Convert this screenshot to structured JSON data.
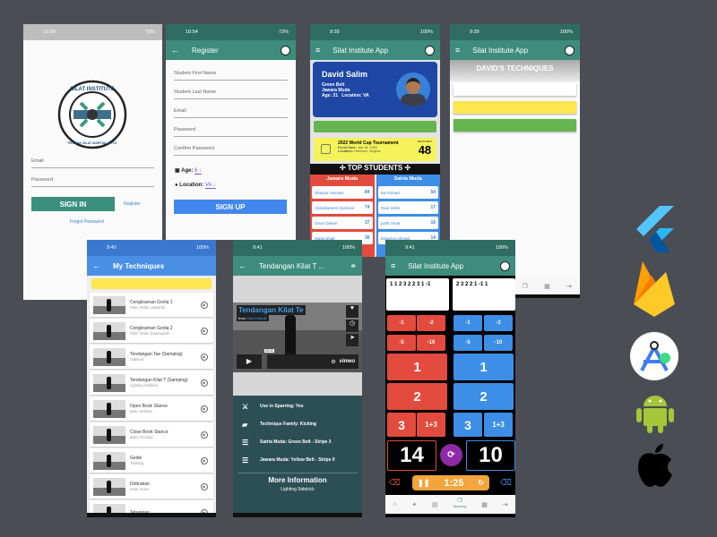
{
  "colors": {
    "teal": "#3d8c7d",
    "teal_dark": "#2f6d62",
    "blue": "#4a8fe6",
    "red": "#e34b3e",
    "yellow": "#f5ef5a",
    "green": "#66b550",
    "purple": "#8e2aa8",
    "orange": "#f2a53a"
  },
  "login": {
    "time": "10:54",
    "battery": "73%",
    "logo_top": "SILAT INSTITUTE",
    "logo_bottom": "PENCAK SILAT MARTIAL ARTS",
    "email_placeholder": "Email",
    "password_placeholder": "Password",
    "sign_in": "SIGN IN",
    "register": "Register",
    "forgot": "Forgot Password"
  },
  "register": {
    "time": "10:54",
    "battery": "73%",
    "title": "Register",
    "fields": [
      "Student First Name",
      "Student Last Name",
      "Email",
      "Password",
      "Confirm Password"
    ],
    "age_label": "Age:",
    "age_value": "6",
    "location_label": "Location:",
    "location_value": "VA",
    "sign_up": "SIGN UP"
  },
  "home": {
    "time": "9:39",
    "battery": "100%",
    "title": "Silat Institute App",
    "name": "David Salim",
    "belt": "Green Belt",
    "level": "Jawara Muda",
    "age": "Age: 21",
    "location": "Location: VA",
    "event": {
      "title": "2022 World Cup Tournament",
      "date_label": "Event Date:",
      "date": "Jan 16, 2022",
      "location_label": "Location:",
      "location": "Herndon, Virginia",
      "days_label": "DAYS LEFT",
      "days": "48"
    },
    "top_title": "TOP STUDENTS",
    "columns": [
      {
        "title": "Jawara Muda",
        "rows": [
          [
            "Shayan Hossain",
            "84"
          ],
          [
            "Abdulkareem Zenhom",
            "74"
          ],
          [
            "Omar Daken",
            "37"
          ],
          [
            "Musa Shafi",
            "36"
          ]
        ]
      },
      {
        "title": "Satria Muda",
        "rows": [
          [
            "Isa Ahmad",
            "54"
          ],
          [
            "Yasir Sefer",
            "17"
          ],
          [
            "Laith Omar",
            "16"
          ],
          [
            "Zakariya Ahmad",
            "14"
          ]
        ]
      }
    ]
  },
  "techniques": {
    "time": "9:39",
    "battery": "100%",
    "title": "Silat Institute App",
    "heading": "DAVID'S TECHNIQUES"
  },
  "my_techniques": {
    "time": "9:40",
    "battery": "100%",
    "title": "My Techniques",
    "items": [
      [
        "Cengkraman Gorila 1",
        "Palm Strike Upwards"
      ],
      [
        "Cengkraman Gorila 2",
        "Palm Strike Downwards"
      ],
      [
        "Tendangan Tae (Samping)",
        "Sidekick"
      ],
      [
        "Tendangan Kilat T (Samping)",
        "Lighting Sidekick"
      ],
      [
        "Open Book Stance",
        "Buku terbuka"
      ],
      [
        "Close Book Stance",
        "Buku Tertutup"
      ],
      [
        "Gelek",
        "Twisting"
      ],
      [
        "Dobrakan",
        "Push move"
      ],
      [
        "Tebangan",
        ""
      ]
    ]
  },
  "video": {
    "time": "9:41",
    "battery": "100%",
    "title": "Tendangan Kilat T ...",
    "video_title": "Tendangan Kilat Te",
    "from": "from",
    "channel": "Silat Institute",
    "timestamp": "00:22",
    "brand": "vimeo",
    "info": [
      [
        "Use in Sparring: Yes",
        "sparring-icon"
      ],
      [
        "Technique Family: Kicking",
        "note-icon"
      ],
      [
        "Satria Muda: Green Belt - Stripe 3",
        "belt-icon"
      ],
      [
        "Jawara Muda: Yellow Belt - Stripe 0",
        "belt-icon"
      ]
    ],
    "more_title": "More Information",
    "more_text": "Lighting Sidekick"
  },
  "scoring": {
    "time": "9:41",
    "battery": "100%",
    "title": "Silat Institute App",
    "red_log": "1 1 2 3 2 2 3 1 -1",
    "blue_log": "2 3 2 2 1 -1 1",
    "minus": [
      "-1",
      "-2",
      "-5",
      "-10"
    ],
    "points": [
      "1",
      "2",
      "3",
      "1+3"
    ],
    "red_score": "14",
    "blue_score": "10",
    "timer": "1:25",
    "nav_active": "Sparring"
  },
  "logos": [
    "flutter",
    "firebase",
    "android-studio",
    "android",
    "apple"
  ]
}
